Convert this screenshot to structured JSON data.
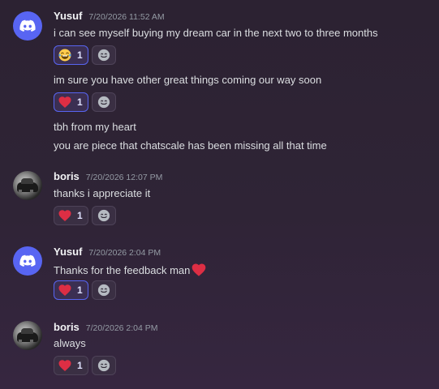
{
  "messages": [
    {
      "username": "Yusuf",
      "timestamp": "7/20/2026 11:52 AM",
      "avatar": "discord-logo",
      "lines": [
        {
          "text": "i can see myself buying my dream car in the next two to three months",
          "reaction": {
            "emoji": "laughing-face",
            "count": "1"
          }
        },
        {
          "text": "im sure you have other great things coming our way soon",
          "reaction": {
            "emoji": "red-heart",
            "count": "1"
          }
        },
        {
          "text": "tbh from my heart"
        },
        {
          "text": "you are piece that chatscale has been missing all that time"
        }
      ]
    },
    {
      "username": "boris",
      "timestamp": "7/20/2026 12:07 PM",
      "avatar": "car-photo",
      "lines": [
        {
          "text": "thanks i appreciate it",
          "reaction": {
            "emoji": "red-heart",
            "count": "1"
          }
        }
      ]
    },
    {
      "username": "Yusuf",
      "timestamp": "7/20/2026 2:04 PM",
      "avatar": "discord-logo",
      "lines": [
        {
          "text": "Thanks for the feedback man",
          "inline_emoji": "red-heart",
          "reaction": {
            "emoji": "red-heart",
            "count": "1"
          }
        }
      ]
    },
    {
      "username": "boris",
      "timestamp": "7/20/2026 2:04 PM",
      "avatar": "car-photo",
      "lines": [
        {
          "text": "always",
          "reaction": {
            "emoji": "red-heart",
            "count": "1"
          }
        }
      ]
    }
  ],
  "colors": {
    "accent": "#5865f2",
    "heart": "#dd2e44",
    "username": "#f2f3f5",
    "timestamp": "#949ba4",
    "text": "#dbdee1"
  }
}
